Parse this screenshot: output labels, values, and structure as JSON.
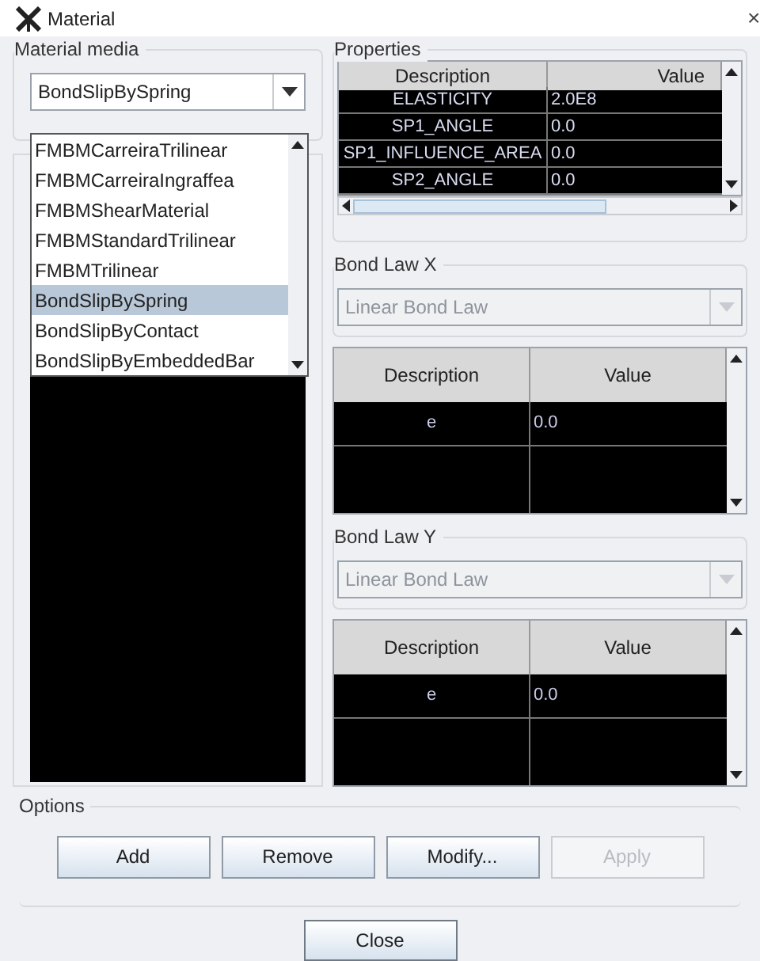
{
  "window": {
    "title": "Material",
    "close": "×"
  },
  "material_media": {
    "label": "Material media",
    "value": "BondSlipBySpring",
    "expanded": true,
    "options": [
      {
        "label": "FMBMCarreiraTrilinear",
        "selected": false
      },
      {
        "label": "FMBMCarreiraIngraffea",
        "selected": false
      },
      {
        "label": "FMBMShearMaterial",
        "selected": false
      },
      {
        "label": "FMBMStandardTrilinear",
        "selected": false
      },
      {
        "label": "FMBMTrilinear",
        "selected": false
      },
      {
        "label": "BondSlipBySpring",
        "selected": true
      },
      {
        "label": "BondSlipByContact",
        "selected": false
      },
      {
        "label": "BondSlipByEmbeddedBar",
        "selected": false
      }
    ]
  },
  "properties": {
    "label": "Properties",
    "columns": [
      "Description",
      "Value"
    ],
    "rows": [
      [
        "ELASTICITY",
        "2.0E8"
      ],
      [
        "SP1_ANGLE",
        "0.0"
      ],
      [
        "SP1_INFLUENCE_AREA",
        "0.0"
      ],
      [
        "SP2_ANGLE",
        "0.0"
      ]
    ]
  },
  "bond_laws": [
    {
      "label": "Bond Law X",
      "combo": {
        "value": "Linear Bond Law",
        "disabled": true
      },
      "columns": [
        "Description",
        "Value"
      ],
      "rows": [
        [
          "e",
          "0.0"
        ]
      ]
    },
    {
      "label": "Bond Law Y",
      "combo": {
        "value": "Linear Bond Law",
        "disabled": true
      },
      "columns": [
        "Description",
        "Value"
      ],
      "rows": [
        [
          "e",
          "0.0"
        ]
      ]
    }
  ],
  "options": {
    "label": "Options",
    "buttons": [
      {
        "label": "Add",
        "disabled": false
      },
      {
        "label": "Remove",
        "disabled": false
      },
      {
        "label": "Modify...",
        "disabled": false
      },
      {
        "label": "Apply",
        "disabled": true
      }
    ]
  },
  "close_button": "Close"
}
